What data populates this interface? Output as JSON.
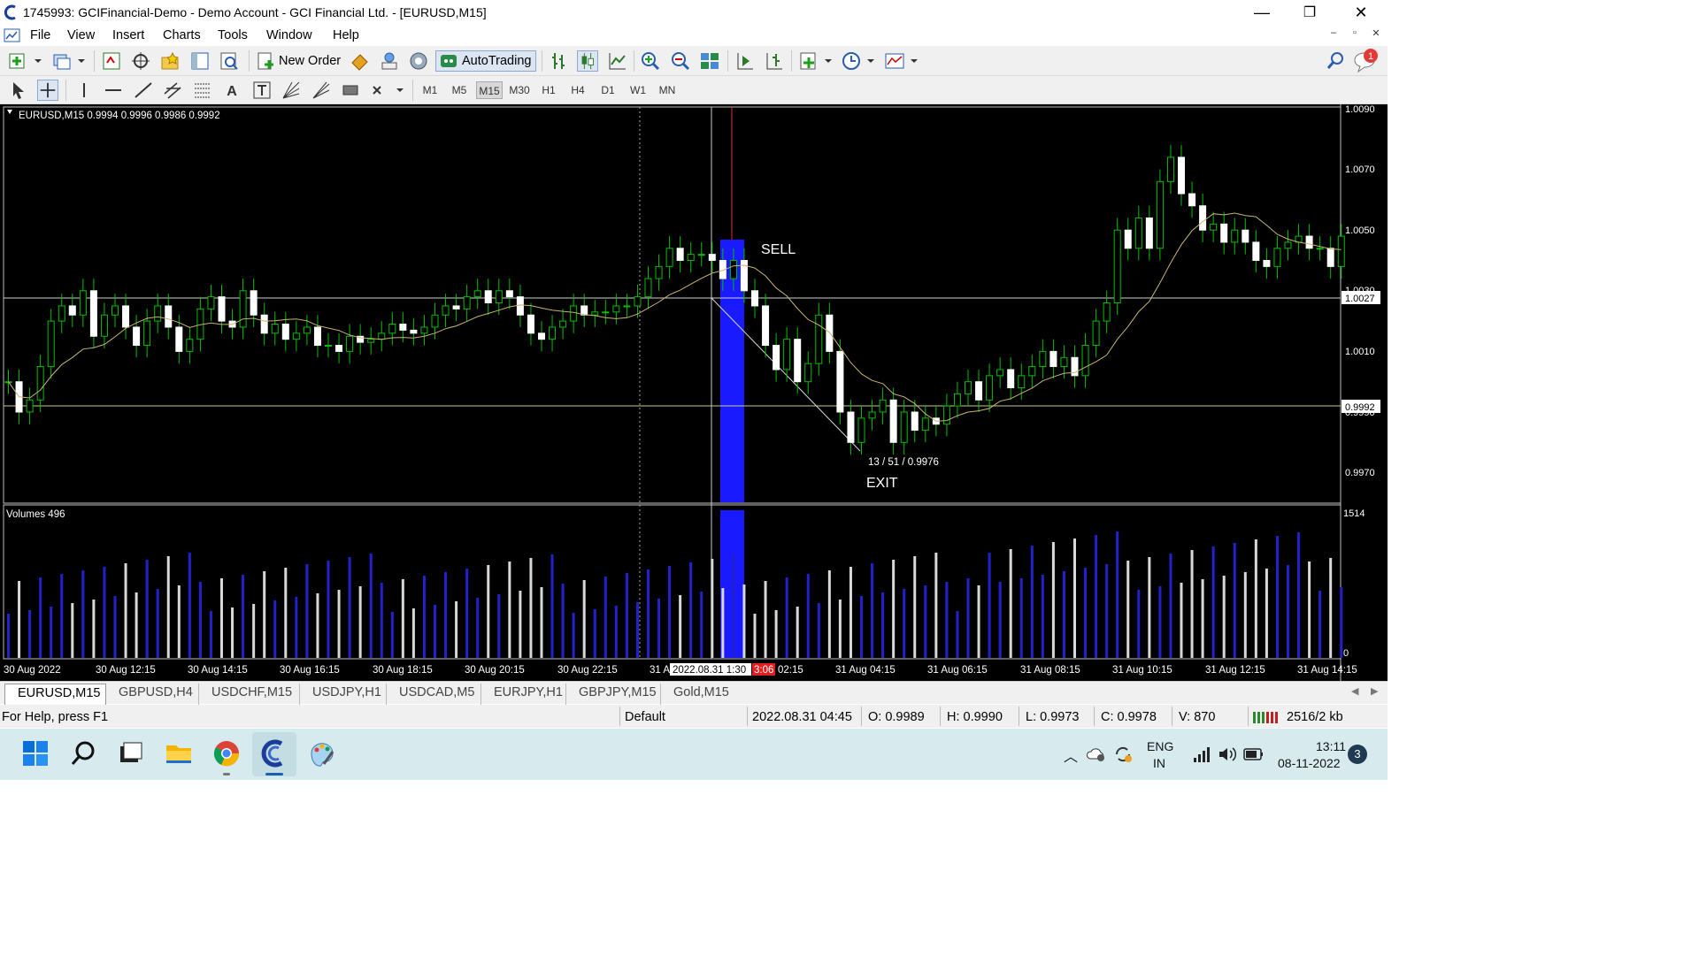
{
  "window": {
    "title": "1745993: GCIFinancial-Demo - Demo Account - GCI Financial Ltd. - [EURUSD,M15]",
    "minimize": "—",
    "restore": "❐",
    "close": "✕"
  },
  "menu": [
    "File",
    "View",
    "Insert",
    "Charts",
    "Tools",
    "Window",
    "Help"
  ],
  "mdi": {
    "minimize": "–",
    "restore": "▫",
    "close": "✕"
  },
  "toolbar": {
    "new_order": "New Order",
    "autotrading": "AutoTrading",
    "notification_count": "1"
  },
  "timeframes": [
    "M1",
    "M5",
    "M15",
    "M30",
    "H1",
    "H4",
    "D1",
    "W1",
    "MN"
  ],
  "active_timeframe": "M15",
  "chart": {
    "header": "EURUSD,M15  0.9994 0.9996 0.9986 0.9992",
    "volume_header": "Volumes 496",
    "sell_label": "SELL",
    "exit_label": "EXIT",
    "trade_info": "13 / 51 / 0.9976",
    "price_axis": [
      "1.0090",
      "1.0070",
      "1.0050",
      "1.0030",
      "1.0010",
      "0.9990",
      "0.9970"
    ],
    "hline_price_1": "1.0027",
    "hline_price_2": "0.9992",
    "volume_axis_max": "1514",
    "volume_axis_min": "0",
    "time_axis": [
      "30 Aug 2022",
      "30 Aug 12:15",
      "30 Aug 14:15",
      "30 Aug 16:15",
      "30 Aug 18:15",
      "30 Aug 20:15",
      "30 Aug 22:15",
      "31 A",
      "02:15",
      "31 Aug 04:15",
      "31 Aug 06:15",
      "31 Aug 08:15",
      "31 Aug 10:15",
      "31 Aug 12:15",
      "31 Aug 14:15"
    ],
    "cursor_time": "2022.08.31 1:30",
    "cursor_time_red": "3:06",
    "colors": {
      "bull": "#00c000",
      "bear": "#ffffff",
      "ma": "#c8b46e",
      "volume_up": "#2222cc",
      "volume_down": "#d8d8d8",
      "highlight": "#1a1aff"
    }
  },
  "tabs": [
    "EURUSD,M15",
    "GBPUSD,H4",
    "USDCHF,M15",
    "USDJPY,H1",
    "USDCAD,M5",
    "EURJPY,H1",
    "GBPJPY,M15",
    "Gold,M15"
  ],
  "active_tab": "EURUSD,M15",
  "status": {
    "help": "For Help, press F1",
    "profile": "Default",
    "datetime": "2022.08.31 04:45",
    "open": "O: 0.9989",
    "high": "H: 0.9990",
    "low": "L: 0.9973",
    "close": "C: 0.9978",
    "volume": "V: 870",
    "traffic": "2516/2 kb"
  },
  "tray": {
    "lang1": "ENG",
    "lang2": "IN",
    "time": "13:11",
    "date": "08-11-2022",
    "badge": "3"
  }
}
